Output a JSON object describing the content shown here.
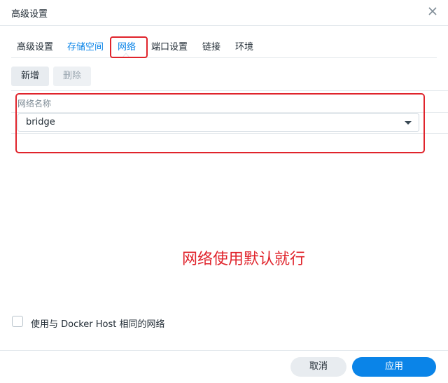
{
  "window": {
    "title": "高级设置",
    "close_icon": "close-icon"
  },
  "tabs": [
    {
      "label": "高级设置",
      "active": false
    },
    {
      "label": "存储空间",
      "active": false
    },
    {
      "label": "网络",
      "active": true
    },
    {
      "label": "端口设置",
      "active": false
    },
    {
      "label": "链接",
      "active": false
    },
    {
      "label": "环境",
      "active": false
    }
  ],
  "toolbar": {
    "add_label": "新增",
    "delete_label": "删除"
  },
  "network_table": {
    "column_header": "网络名称",
    "selected_network": "bridge",
    "dropdown_icon": "chevron-down-icon"
  },
  "annotation": {
    "text": "网络使用默认就行",
    "color": "#e0242c"
  },
  "option": {
    "label": "使用与 Docker Host 相同的网络",
    "checked": false
  },
  "footer": {
    "cancel_label": "取消",
    "apply_label": "应用"
  },
  "colors": {
    "accent": "#0a84e8",
    "annotation": "#e0242c"
  }
}
